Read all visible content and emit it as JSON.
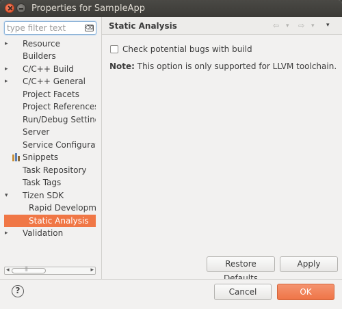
{
  "window": {
    "title": "Properties for SampleApp"
  },
  "filter": {
    "placeholder": "type filter text"
  },
  "tree": {
    "items": [
      {
        "label": "Resource",
        "expander": "▸"
      },
      {
        "label": "Builders",
        "expander": ""
      },
      {
        "label": "C/C++ Build",
        "expander": "▸"
      },
      {
        "label": "C/C++ General",
        "expander": "▸"
      },
      {
        "label": "Project Facets",
        "expander": ""
      },
      {
        "label": "Project References",
        "expander": ""
      },
      {
        "label": "Run/Debug Settings",
        "expander": ""
      },
      {
        "label": "Server",
        "expander": ""
      },
      {
        "label": "Service Configuration",
        "expander": ""
      },
      {
        "label": "Snippets",
        "expander": ""
      },
      {
        "label": "Task Repository",
        "expander": ""
      },
      {
        "label": "Task Tags",
        "expander": ""
      },
      {
        "label": "Tizen SDK",
        "expander": "▾"
      },
      {
        "label": "Rapid Development",
        "expander": ""
      },
      {
        "label": "Static Analysis",
        "expander": ""
      },
      {
        "label": "Validation",
        "expander": "▸"
      }
    ]
  },
  "page": {
    "title": "Static Analysis",
    "checkbox_label": "Check potential bugs with build",
    "checkbox_checked": false,
    "note_prefix": "Note:",
    "note_text": " This option is only supported for LLVM toolchain."
  },
  "buttons": {
    "restore_defaults": "Restore Defaults",
    "apply": "Apply",
    "cancel": "Cancel",
    "ok": "OK",
    "help": "?"
  },
  "icons": {
    "nav_back": "⇦",
    "nav_forward": "⇨",
    "dropdown": "▾",
    "clear": "⌫",
    "snippets": "snippets-icon"
  },
  "colors": {
    "selection": "#f07746",
    "titlebar": "#3c3b37",
    "ok_button": "#ef7547"
  }
}
